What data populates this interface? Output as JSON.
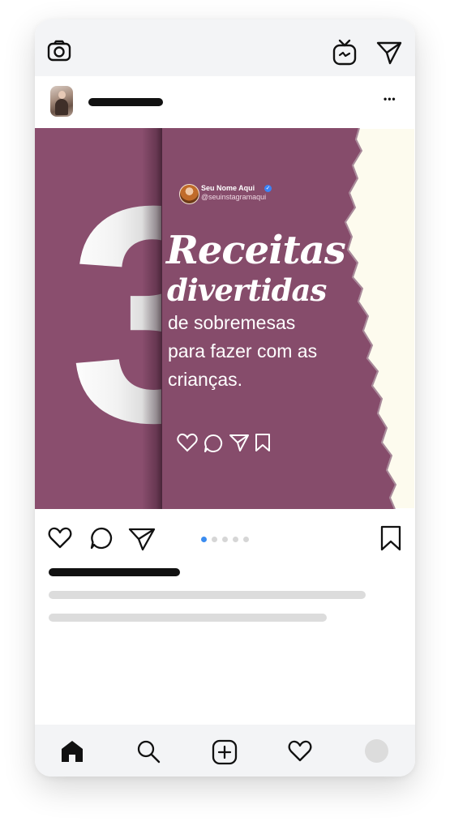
{
  "top_bar": {
    "camera_icon": "camera-icon",
    "igtv_icon": "igtv-icon",
    "direct_icon": "paper-plane-icon"
  },
  "post_header": {
    "avatar": "user-avatar",
    "menu_icon": "more-options-icon",
    "menu_glyph": "•••"
  },
  "post_image": {
    "number": "3",
    "profile_name": "Seu Nome Aqui",
    "verified_glyph": "✓",
    "profile_handle": "@seuinstagramaqui",
    "headline_1": "Receitas",
    "headline_2": "divertidas",
    "body_lines": [
      "de sobremesas",
      "para fazer com as",
      "crianças."
    ],
    "colors": {
      "panel": "#864c6b",
      "paper": "#fdfbee",
      "number_fill": "#ffffff"
    },
    "inner_icons": [
      "heart-icon",
      "comment-icon",
      "send-icon",
      "bookmark-icon"
    ]
  },
  "actions": {
    "like_icon": "heart-icon",
    "comment_icon": "comment-icon",
    "share_icon": "paper-plane-icon",
    "save_icon": "bookmark-icon",
    "carousel": {
      "count": 5,
      "active_index": 0,
      "active_color": "#3b8cf0"
    }
  },
  "bottom_nav": {
    "items": [
      "home-icon",
      "search-icon",
      "add-post-icon",
      "activity-heart-icon",
      "profile-icon"
    ]
  }
}
